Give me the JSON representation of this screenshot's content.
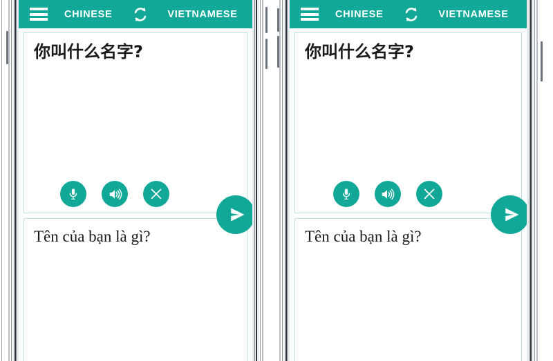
{
  "app": {
    "accent_color": "#11a898",
    "panel_border_color": "#bfe3dd",
    "text_color": "#1a1a1a"
  },
  "header": {
    "menu_icon": "hamburger-menu-icon",
    "source_language": "CHINESE",
    "swap_icon": "swap-languages-icon",
    "target_language": "VIETNAMESE"
  },
  "source_panel": {
    "text": "你叫什么名字?",
    "placeholder": "",
    "buttons": [
      {
        "name": "microphone-button",
        "icon": "microphone-icon"
      },
      {
        "name": "speaker-button",
        "icon": "speaker-icon"
      },
      {
        "name": "clear-button",
        "icon": "close-x-icon"
      }
    ]
  },
  "target_panel": {
    "text": "Tên của bạn là gì?"
  },
  "send_button": {
    "icon": "send-paper-plane-icon",
    "label": "Send"
  },
  "screens": [
    {
      "id": "screen-left",
      "name": "phone-screenshot-left"
    },
    {
      "id": "screen-right",
      "name": "phone-screenshot-right"
    }
  ]
}
